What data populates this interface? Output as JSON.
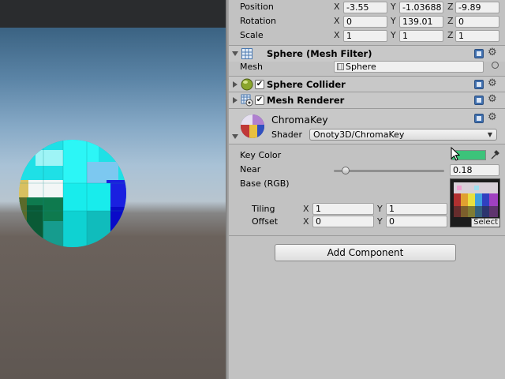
{
  "colors": {
    "key_color": "#3cc37a",
    "accent_blue": "#3f6fae",
    "panel_bg": "#c2c2c2"
  },
  "transform": {
    "position": {
      "label": "Position",
      "x": "-3.55",
      "y": "-1.03688",
      "z": "-9.89"
    },
    "rotation": {
      "label": "Rotation",
      "x": "0",
      "y": "139.01",
      "z": "0"
    },
    "scale": {
      "label": "Scale",
      "x": "1",
      "y": "1",
      "z": "1"
    },
    "axis": {
      "x": "X",
      "y": "Y",
      "z": "Z"
    }
  },
  "mesh_filter": {
    "title": "Sphere (Mesh Filter)",
    "mesh_label": "Mesh",
    "mesh_value": "Sphere"
  },
  "sphere_collider": {
    "title": "Sphere Collider",
    "enabled": "✔"
  },
  "mesh_renderer": {
    "title": "Mesh Renderer",
    "enabled": "✔"
  },
  "material": {
    "name": "ChromaKey",
    "shader_label": "Shader",
    "shader_value": "Onoty3D/ChromaKey",
    "key_color_label": "Key Color",
    "near_label": "Near",
    "near_value": "0.18",
    "near_fraction": 0.11,
    "base_label": "Base (RGB)",
    "tiling_label": "Tiling",
    "offset_label": "Offset",
    "tiling": {
      "x": "1",
      "y": "1"
    },
    "offset": {
      "x": "0",
      "y": "0"
    },
    "select_label": "Select"
  },
  "add_component_label": "Add Component",
  "icons": {
    "mesh_filter": "grid-mesh-icon",
    "sphere_collider": "sphere-collider-icon",
    "mesh_renderer": "mesh-renderer-icon",
    "material_preview": "material-sphere-preview-icon",
    "help": "help-book-icon",
    "settings": "gear-icon",
    "eyedropper": "eyedropper-icon",
    "object_picker": "object-picker-icon"
  }
}
